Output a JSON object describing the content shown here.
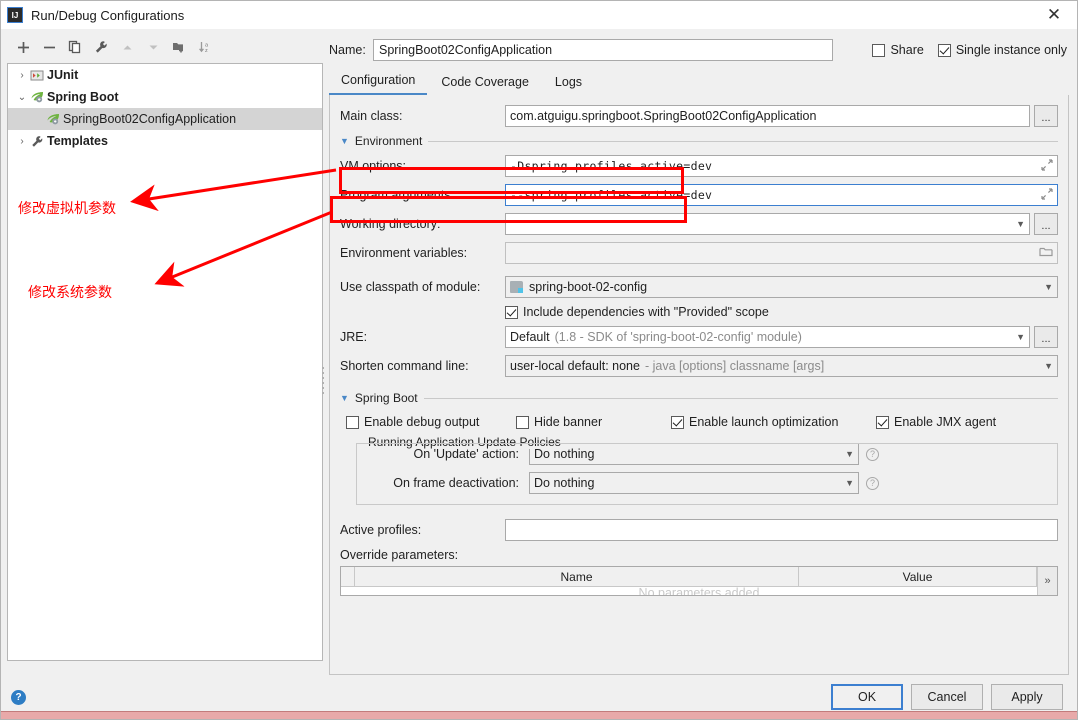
{
  "window": {
    "title": "Run/Debug Configurations",
    "logo_text": "IJ",
    "close_icon": "✕"
  },
  "toolbar": {
    "items": [
      {
        "name": "add-configuration",
        "icon": "plus-icon"
      },
      {
        "name": "remove-configuration",
        "icon": "minus-icon"
      },
      {
        "name": "copy-configuration",
        "icon": "copy-icon"
      },
      {
        "name": "edit-templates",
        "icon": "wrench-icon"
      },
      {
        "name": "move-up",
        "icon": "arrow-up-icon"
      },
      {
        "name": "move-down",
        "icon": "arrow-down-icon"
      },
      {
        "name": "create-folder",
        "icon": "folder-plus-icon"
      },
      {
        "name": "sort-configurations",
        "icon": "sort-alpha-icon"
      }
    ]
  },
  "tree": {
    "nodes": [
      {
        "label": "JUnit",
        "chevron": "›",
        "icon": "junit-icon",
        "bold": true,
        "selected": false,
        "indent": 0
      },
      {
        "label": "Spring Boot",
        "chevron": "⌄",
        "icon": "spring-leaf-icon",
        "bold": true,
        "selected": false,
        "indent": 0
      },
      {
        "label": "SpringBoot02ConfigApplication",
        "chevron": "",
        "icon": "spring-leaf-icon",
        "bold": false,
        "selected": true,
        "indent": 1
      },
      {
        "label": "Templates",
        "chevron": "›",
        "icon": "wrench-icon",
        "bold": true,
        "selected": false,
        "indent": 0
      }
    ]
  },
  "annotations": [
    {
      "text": "修改虚拟机参数",
      "color": "#ff0000"
    },
    {
      "text": "修改系统参数",
      "color": "#ff0000"
    }
  ],
  "name_row": {
    "label": "Name:",
    "value": "SpringBoot02ConfigApplication",
    "share_label": "Share",
    "share_checked": false,
    "single_instance_label": "Single instance only",
    "single_instance_checked": true
  },
  "tabs": [
    {
      "label": "Configuration",
      "active": true
    },
    {
      "label": "Code Coverage",
      "active": false
    },
    {
      "label": "Logs",
      "active": false
    }
  ],
  "form": {
    "main_class_label": "Main class:",
    "main_class_value": "com.atguigu.springboot.SpringBoot02ConfigApplication",
    "ellipsis": "...",
    "environment_section": "Environment",
    "vm_options_label": "VM options:",
    "vm_options_value": "-Dspring.profiles.active=dev",
    "program_arguments_label": "Program arguments:",
    "program_arguments_value": "--spring.profiles.active=dev",
    "working_directory_label": "Working directory:",
    "working_directory_value": "",
    "environment_variables_label": "Environment variables:",
    "environment_variables_value": "",
    "classpath_label": "Use classpath of module:",
    "classpath_value": "spring-boot-02-config",
    "include_deps_label": "Include dependencies with \"Provided\" scope",
    "include_deps_checked": true,
    "jre_label": "JRE:",
    "jre_value": "Default",
    "jre_hint": "(1.8 - SDK of 'spring-boot-02-config' module)",
    "shorten_label": "Shorten command line:",
    "shorten_value": "user-local default: none",
    "shorten_hint": "- java [options] classname [args]"
  },
  "spring_boot": {
    "section_label": "Spring Boot",
    "checkboxes": [
      {
        "label": "Enable debug output",
        "checked": false
      },
      {
        "label": "Hide banner",
        "checked": false
      },
      {
        "label": "Enable launch optimization",
        "checked": true
      },
      {
        "label": "Enable JMX agent",
        "checked": true
      }
    ],
    "policies_legend": "Running Application Update Policies",
    "on_update_label": "On 'Update' action:",
    "on_update_value": "Do nothing",
    "on_frame_label": "On frame deactivation:",
    "on_frame_value": "Do nothing",
    "help_glyph": "?",
    "active_profiles_label": "Active profiles:",
    "active_profiles_value": "",
    "override_params_label": "Override parameters:",
    "table": {
      "columns": [
        "Name",
        "Value"
      ],
      "empty_text": "No parameters added",
      "more_glyph": "»"
    }
  },
  "footer": {
    "help_glyph": "?",
    "buttons": [
      {
        "label": "OK",
        "primary": true
      },
      {
        "label": "Cancel",
        "primary": false
      },
      {
        "label": "Apply",
        "primary": false
      }
    ]
  }
}
